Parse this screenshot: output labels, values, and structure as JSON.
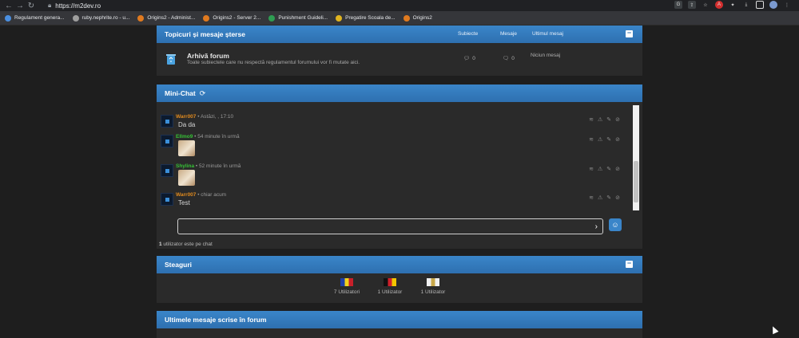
{
  "browser": {
    "url": "https://m2dev.ro",
    "bookmarks": [
      {
        "label": "Regulament genera...",
        "color": "#4a8fe0"
      },
      {
        "label": "ruby.nephrite.ro - u...",
        "color": "#9e9e9e"
      },
      {
        "label": "Origins2 - Administ...",
        "color": "#e07a1f"
      },
      {
        "label": "Origins2 - Server 2...",
        "color": "#e07a1f"
      },
      {
        "label": "Punishment Guideli...",
        "color": "#2e9d52"
      },
      {
        "label": "Pregatire Scoala de...",
        "color": "#e0b41f"
      },
      {
        "label": "Origins2",
        "color": "#e07a1f"
      }
    ]
  },
  "deleted_panel": {
    "title": "Topicuri și mesaje șterse",
    "col_subjects": "Subiecte",
    "col_messages": "Mesaje",
    "col_last": "Ultimul mesaj",
    "forum": {
      "name": "Arhivă forum",
      "description": "Toate subiectele care nu respectă regulamentul forumului vor fi mutate aici.",
      "subjects": "0",
      "messages": "0",
      "last": "Niciun mesaj"
    }
  },
  "minichat": {
    "title": "Mini-Chat",
    "messages": [
      {
        "user": "Warr007",
        "user_color": "#e08a1e",
        "time": " • Astăzi, , 17:10",
        "text": "Da da",
        "has_image": false
      },
      {
        "user": "Ellmo9",
        "user_color": "#36c236",
        "time": " • 54 minute în urmă",
        "text": "",
        "has_image": true
      },
      {
        "user": "Shylina",
        "user_color": "#36c236",
        "time": " • 52 minute în urmă",
        "text": "",
        "has_image": true
      },
      {
        "user": "Warr007",
        "user_color": "#e08a1e",
        "time": " • chiar acum",
        "text": "Test",
        "has_image": false
      }
    ],
    "input_placeholder": "",
    "users_count": "1",
    "users_text": " utilizator este pe chat"
  },
  "flags_panel": {
    "title": "Steaguri",
    "flags": [
      {
        "label": "7 Utilizatori",
        "colors": [
          "#1f3fa8",
          "#f2d21b",
          "#c8202a"
        ]
      },
      {
        "label": "1 Utilizator",
        "colors": [
          "#111111",
          "#d0202a",
          "#f2c500"
        ]
      },
      {
        "label": "1 Utilizator",
        "colors": [
          "#f0f0f0",
          "#c8a84a",
          "#f0f0f0"
        ]
      }
    ]
  },
  "latest_panel": {
    "title": "Ultimele mesaje scrise în forum"
  }
}
